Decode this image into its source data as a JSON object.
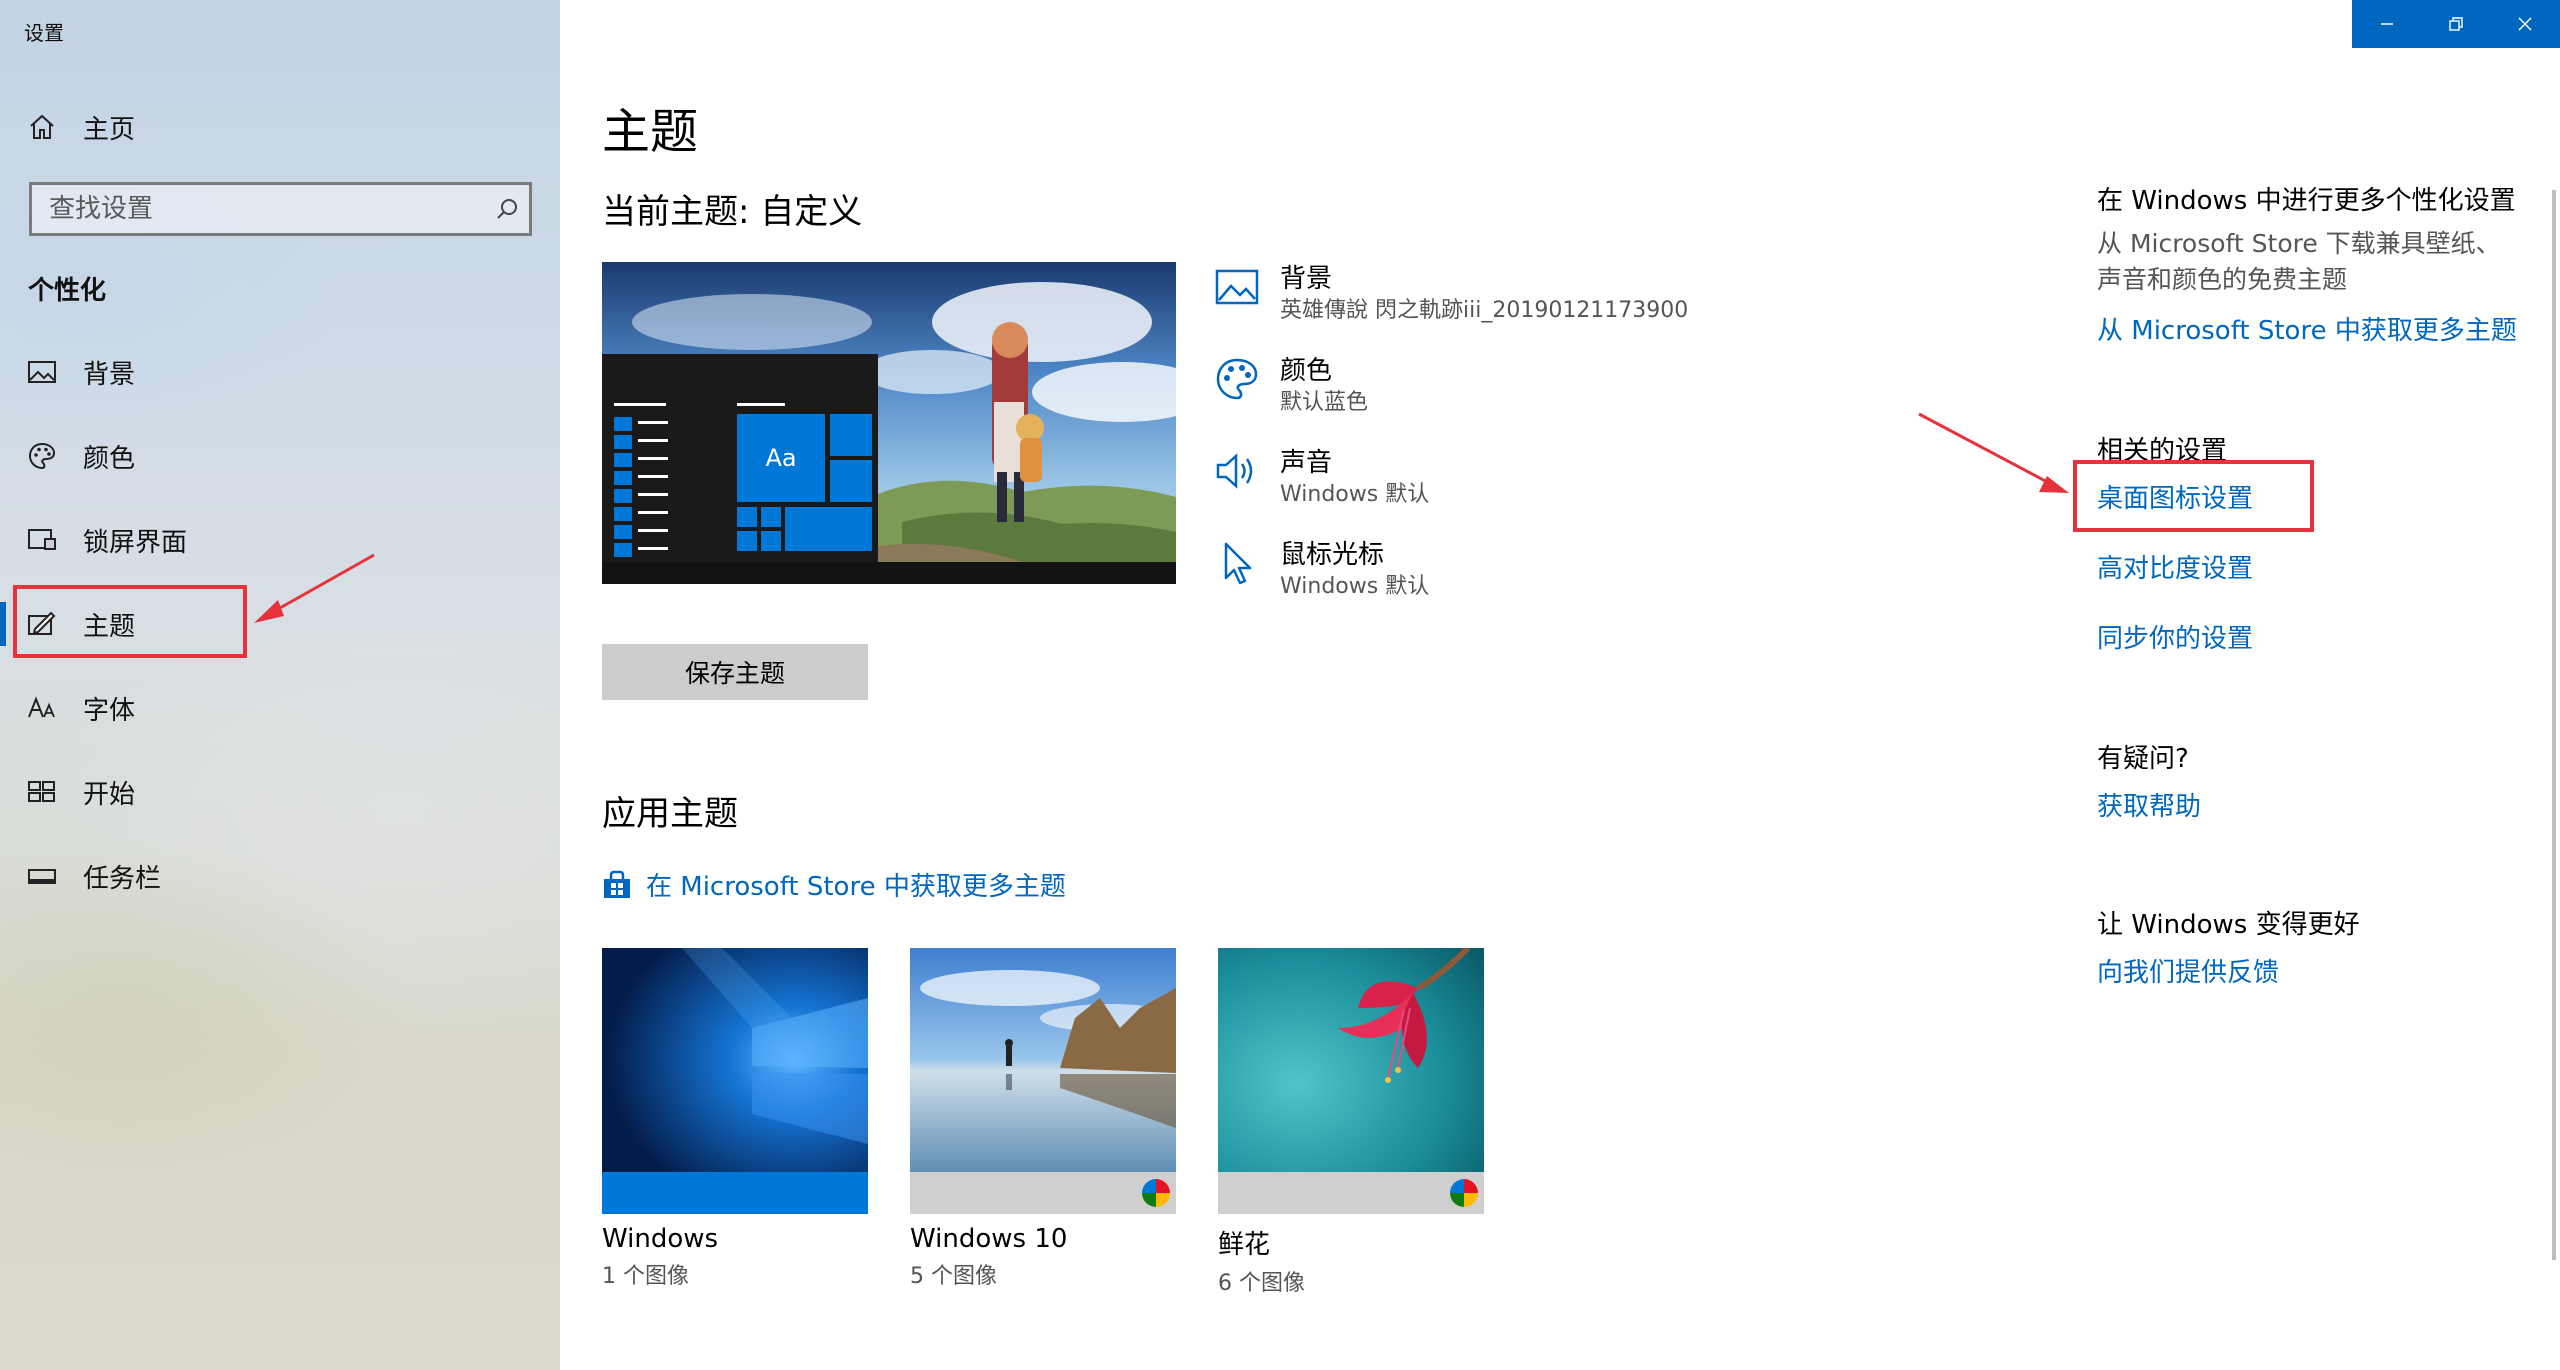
{
  "window": {
    "title": "设置"
  },
  "sidebar": {
    "home_label": "主页",
    "search_placeholder": "查找设置",
    "section": "个性化",
    "items": [
      {
        "label": "背景",
        "icon": "picture-icon"
      },
      {
        "label": "颜色",
        "icon": "palette-icon"
      },
      {
        "label": "锁屏界面",
        "icon": "lock-screen-icon"
      },
      {
        "label": "主题",
        "icon": "theme-icon",
        "active": true
      },
      {
        "label": "字体",
        "icon": "font-icon"
      },
      {
        "label": "开始",
        "icon": "start-icon"
      },
      {
        "label": "任务栏",
        "icon": "taskbar-icon"
      }
    ]
  },
  "main": {
    "title": "主题",
    "current_theme": "当前主题: 自定义",
    "preview_sample_text": "Aa",
    "properties": [
      {
        "name": "背景",
        "value": "英雄傳說 閃之軌跡iii_20190121173900",
        "icon": "picture-icon"
      },
      {
        "name": "颜色",
        "value": "默认蓝色",
        "icon": "palette-icon"
      },
      {
        "name": "声音",
        "value": "Windows 默认",
        "icon": "speaker-icon"
      },
      {
        "name": "鼠标光标",
        "value": "Windows 默认",
        "icon": "cursor-icon"
      }
    ],
    "save_button": "保存主题",
    "apply_title": "应用主题",
    "store_link": "在 Microsoft Store 中获取更多主题",
    "themes": [
      {
        "name": "Windows",
        "count": "1 个图像"
      },
      {
        "name": "Windows 10",
        "count": "5 个图像"
      },
      {
        "name": "鲜花",
        "count": "6 个图像"
      }
    ]
  },
  "right": {
    "more_title": "在 Windows 中进行更多个性化设置",
    "more_desc": "从 Microsoft Store 下载兼具壁纸、声音和颜色的免费主题",
    "more_link": "从 Microsoft Store 中获取更多主题",
    "related_title": "相关的设置",
    "related_links": [
      "桌面图标设置",
      "高对比度设置",
      "同步你的设置"
    ],
    "help_title": "有疑问?",
    "help_link": "获取帮助",
    "feedback_title": "让 Windows 变得更好",
    "feedback_link": "向我们提供反馈"
  },
  "colors": {
    "accent": "#0067c0",
    "highlight_box": "#e6323c"
  }
}
